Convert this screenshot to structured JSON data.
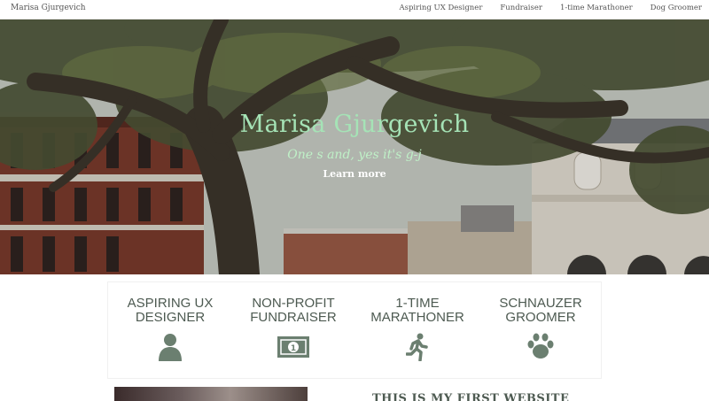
{
  "nav": {
    "brand": "Marisa Gjurgevich",
    "links": [
      "Aspiring UX Designer",
      "Fundraiser",
      "1-time Marathoner",
      "Dog Groomer"
    ]
  },
  "hero": {
    "title": "Marisa Gjurgevich",
    "subtitle": "One s and, yes it's g-j",
    "button": "Learn more"
  },
  "features": [
    {
      "line1": "ASPIRING UX",
      "line2": "DESIGNER",
      "icon": "user-icon"
    },
    {
      "line1": "NON-PROFIT",
      "line2": "FUNDRAISER",
      "icon": "money-icon"
    },
    {
      "line1": "1-TIME",
      "line2": "MARATHONER",
      "icon": "runner-icon"
    },
    {
      "line1": "SCHNAUZER",
      "line2": "GROOMER",
      "icon": "paw-icon"
    }
  ],
  "content": {
    "heading": "THIS IS MY FIRST WEBSITE"
  },
  "colors": {
    "accent": "#a5e3b6",
    "icon": "#6b7f70",
    "label": "#4d5a51"
  }
}
